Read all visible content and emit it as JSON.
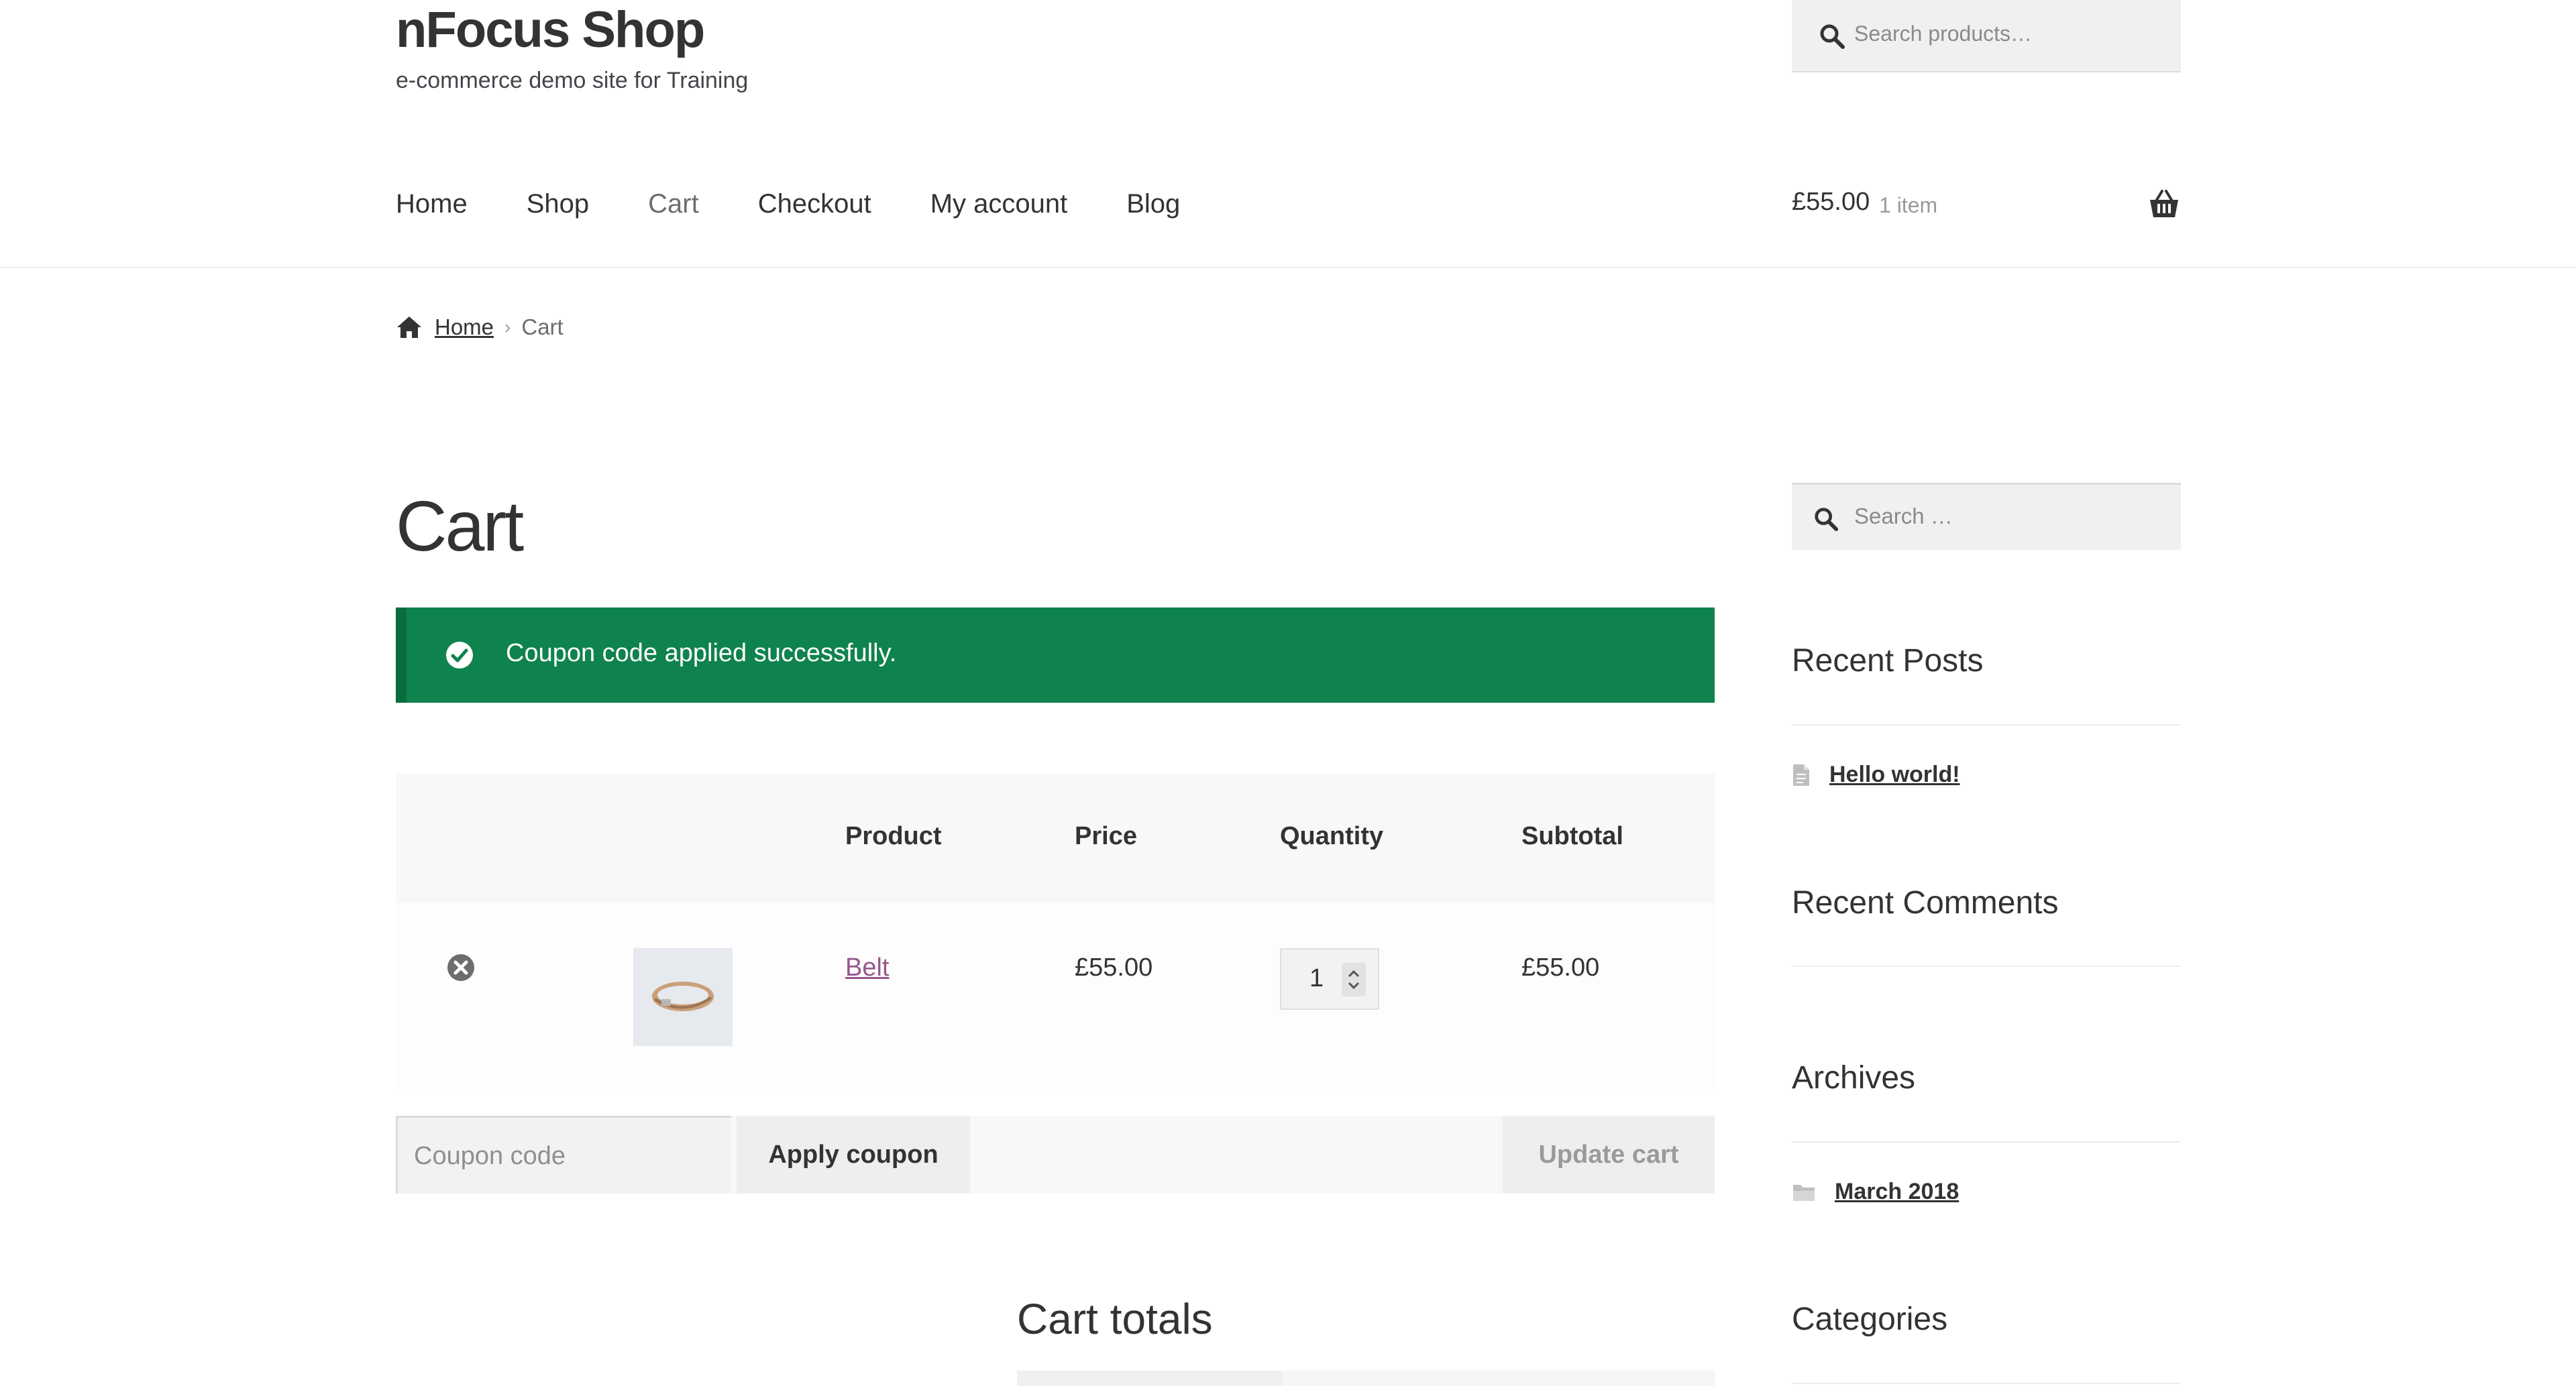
{
  "site": {
    "title": "nFocus Shop",
    "tagline": "e-commerce demo site for Training"
  },
  "header_search": {
    "placeholder": "Search products…"
  },
  "nav": {
    "items": [
      "Home",
      "Shop",
      "Cart",
      "Checkout",
      "My account",
      "Blog"
    ],
    "current": "Cart"
  },
  "mini_cart": {
    "amount": "£55.00",
    "count": "1 item"
  },
  "breadcrumb": {
    "home": "Home",
    "current": "Cart"
  },
  "page": {
    "title": "Cart"
  },
  "notice": {
    "message": "Coupon code applied successfully.",
    "color": "#0f834d"
  },
  "cart_table": {
    "headers": {
      "product": "Product",
      "price": "Price",
      "quantity": "Quantity",
      "subtotal": "Subtotal"
    },
    "rows": [
      {
        "product": "Belt",
        "price": "£55.00",
        "quantity": "1",
        "subtotal": "£55.00"
      }
    ]
  },
  "actions": {
    "coupon_placeholder": "Coupon code",
    "apply_label": "Apply coupon",
    "update_label": "Update cart"
  },
  "totals": {
    "title": "Cart totals"
  },
  "sidebar": {
    "search_placeholder": "Search …",
    "recent_posts_title": "Recent Posts",
    "recent_posts": [
      "Hello world!"
    ],
    "recent_comments_title": "Recent Comments",
    "archives_title": "Archives",
    "archives": [
      "March 2018"
    ],
    "categories_title": "Categories"
  },
  "colors": {
    "link": "#96588a",
    "success": "#0f834d",
    "text": "#333333"
  }
}
